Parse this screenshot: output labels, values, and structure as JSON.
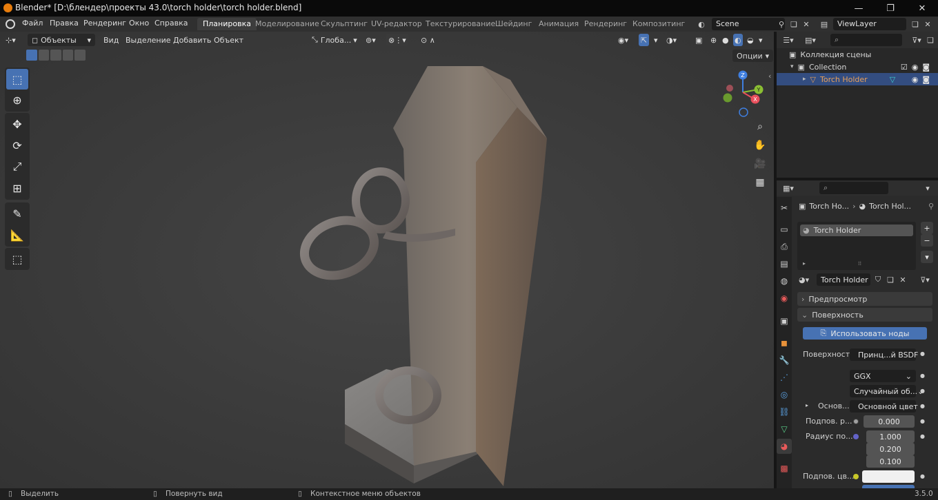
{
  "titlebar": {
    "title": "Blender* [D:\\блендер\\проекты 43.0\\torch holder\\torch holder.blend]",
    "minimize": "—",
    "maximize": "❐",
    "close": "✕"
  },
  "menu": {
    "items": [
      "Файл",
      "Правка",
      "Рендеринг",
      "Окно",
      "Справка"
    ]
  },
  "workspaces": [
    "Планировка",
    "Моделирование",
    "Скульптинг",
    "UV-редактор",
    "Текстурирование",
    "Шейдинг",
    "Анимация",
    "Рендеринг",
    "Композитинг"
  ],
  "workspace_active": "Планировка",
  "scene": {
    "name": "Scene",
    "view_layer": "ViewLayer"
  },
  "viewport_header": {
    "mode": "Объекты",
    "menus": [
      "Вид",
      "Выделение",
      "Добавить",
      "Объект"
    ],
    "transform_orientation": "Глоба...",
    "options": "Опции"
  },
  "gizmo": {
    "x": "X",
    "y": "Y",
    "z": "Z"
  },
  "outliner": {
    "scene_collection": "Коллекция сцены",
    "collection": "Collection",
    "object": "Torch Holder"
  },
  "properties": {
    "breadcrumb_object": "Torch Ho...",
    "breadcrumb_material": "Torch Hol...",
    "material_slot": "Torch Holder",
    "material_name": "Torch Holder",
    "panel_preview": "Предпросмотр",
    "panel_surface": "Поверхность",
    "use_nodes": "Использовать ноды",
    "surface_label": "Поверхность",
    "surface_value": "Принц...й BSDF",
    "distribution": "GGX",
    "subsurface_method": "Случайный об...",
    "base_label": "Основ...",
    "base_value": "Основной цвет",
    "subsurface_label": "Подпов. р...",
    "subsurface_value": "0.000",
    "radius_label": "Радиус по...",
    "radius_values": [
      "1.000",
      "0.200",
      "0.100"
    ],
    "subsurface_color_label": "Подпов. цв..."
  },
  "statusbar": {
    "select": "Выделить",
    "rotate": "Повернуть вид",
    "context": "Контекстное меню объектов",
    "version": "3.5.0"
  },
  "colors": {
    "accent": "#4772b3",
    "selected_row": "#334d80",
    "object_orange": "#e8a05a",
    "gizmo_x": "#e84f5c",
    "gizmo_y": "#8bbf33",
    "gizmo_z": "#3f7fe0"
  }
}
